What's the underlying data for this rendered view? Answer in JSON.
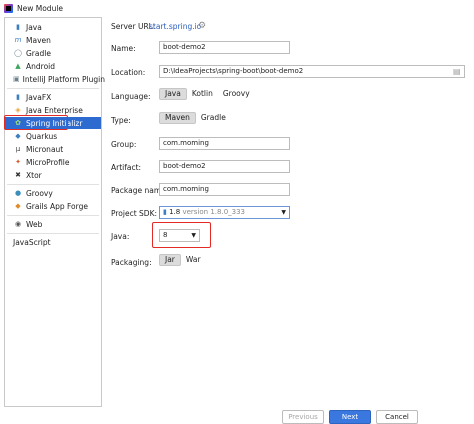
{
  "window": {
    "title": "New Module"
  },
  "sidebar": {
    "items": [
      {
        "label": "Java",
        "icon": "folder-icon"
      },
      {
        "label": "Maven",
        "icon": "maven-icon"
      },
      {
        "label": "Gradle",
        "icon": "gradle-icon"
      },
      {
        "label": "Android",
        "icon": "android-icon"
      },
      {
        "label": "IntelliJ Platform Plugin",
        "icon": "plugin-icon"
      },
      {
        "label": "JavaFX",
        "icon": "folder-icon"
      },
      {
        "label": "Java Enterprise",
        "icon": "java-enterprise-icon"
      },
      {
        "label": "Spring Initializr",
        "icon": "spring-icon"
      },
      {
        "label": "Quarkus",
        "icon": "quarkus-icon"
      },
      {
        "label": "Micronaut",
        "icon": "micronaut-icon"
      },
      {
        "label": "MicroProfile",
        "icon": "microprofile-icon"
      },
      {
        "label": "Xtor",
        "icon": "xtor-icon"
      },
      {
        "label": "Groovy",
        "icon": "groovy-icon"
      },
      {
        "label": "Grails App Forge",
        "icon": "grails-icon"
      },
      {
        "label": "Web",
        "icon": "globe-icon"
      },
      {
        "label": "JavaScript",
        "icon": ""
      }
    ]
  },
  "form": {
    "server_url_label": "Server URL:",
    "server_url_value": "start.spring.io",
    "name_label": "Name:",
    "name_value": "boot-demo2",
    "location_label": "Location:",
    "location_value": "D:\\IdeaProjects\\spring-boot\\boot-demo2",
    "language_label": "Language:",
    "language_options": [
      "Java",
      "Kotlin",
      "Groovy"
    ],
    "type_label": "Type:",
    "type_options": [
      "Maven",
      "Gradle"
    ],
    "group_label": "Group:",
    "group_value": "com.moming",
    "artifact_label": "Artifact:",
    "artifact_value": "boot-demo2",
    "package_label": "Package name:",
    "package_value": "com.moming",
    "sdk_label": "Project SDK:",
    "sdk_value": "1.8",
    "sdk_version": "version 1.8.0_333",
    "java_label": "Java:",
    "java_value": "8",
    "packaging_label": "Packaging:",
    "packaging_options": [
      "Jar",
      "War"
    ]
  },
  "buttons": {
    "previous": "Previous",
    "next": "Next",
    "cancel": "Cancel"
  },
  "colors": {
    "accent": "#2e6bd1",
    "highlight": "#e42a24"
  }
}
